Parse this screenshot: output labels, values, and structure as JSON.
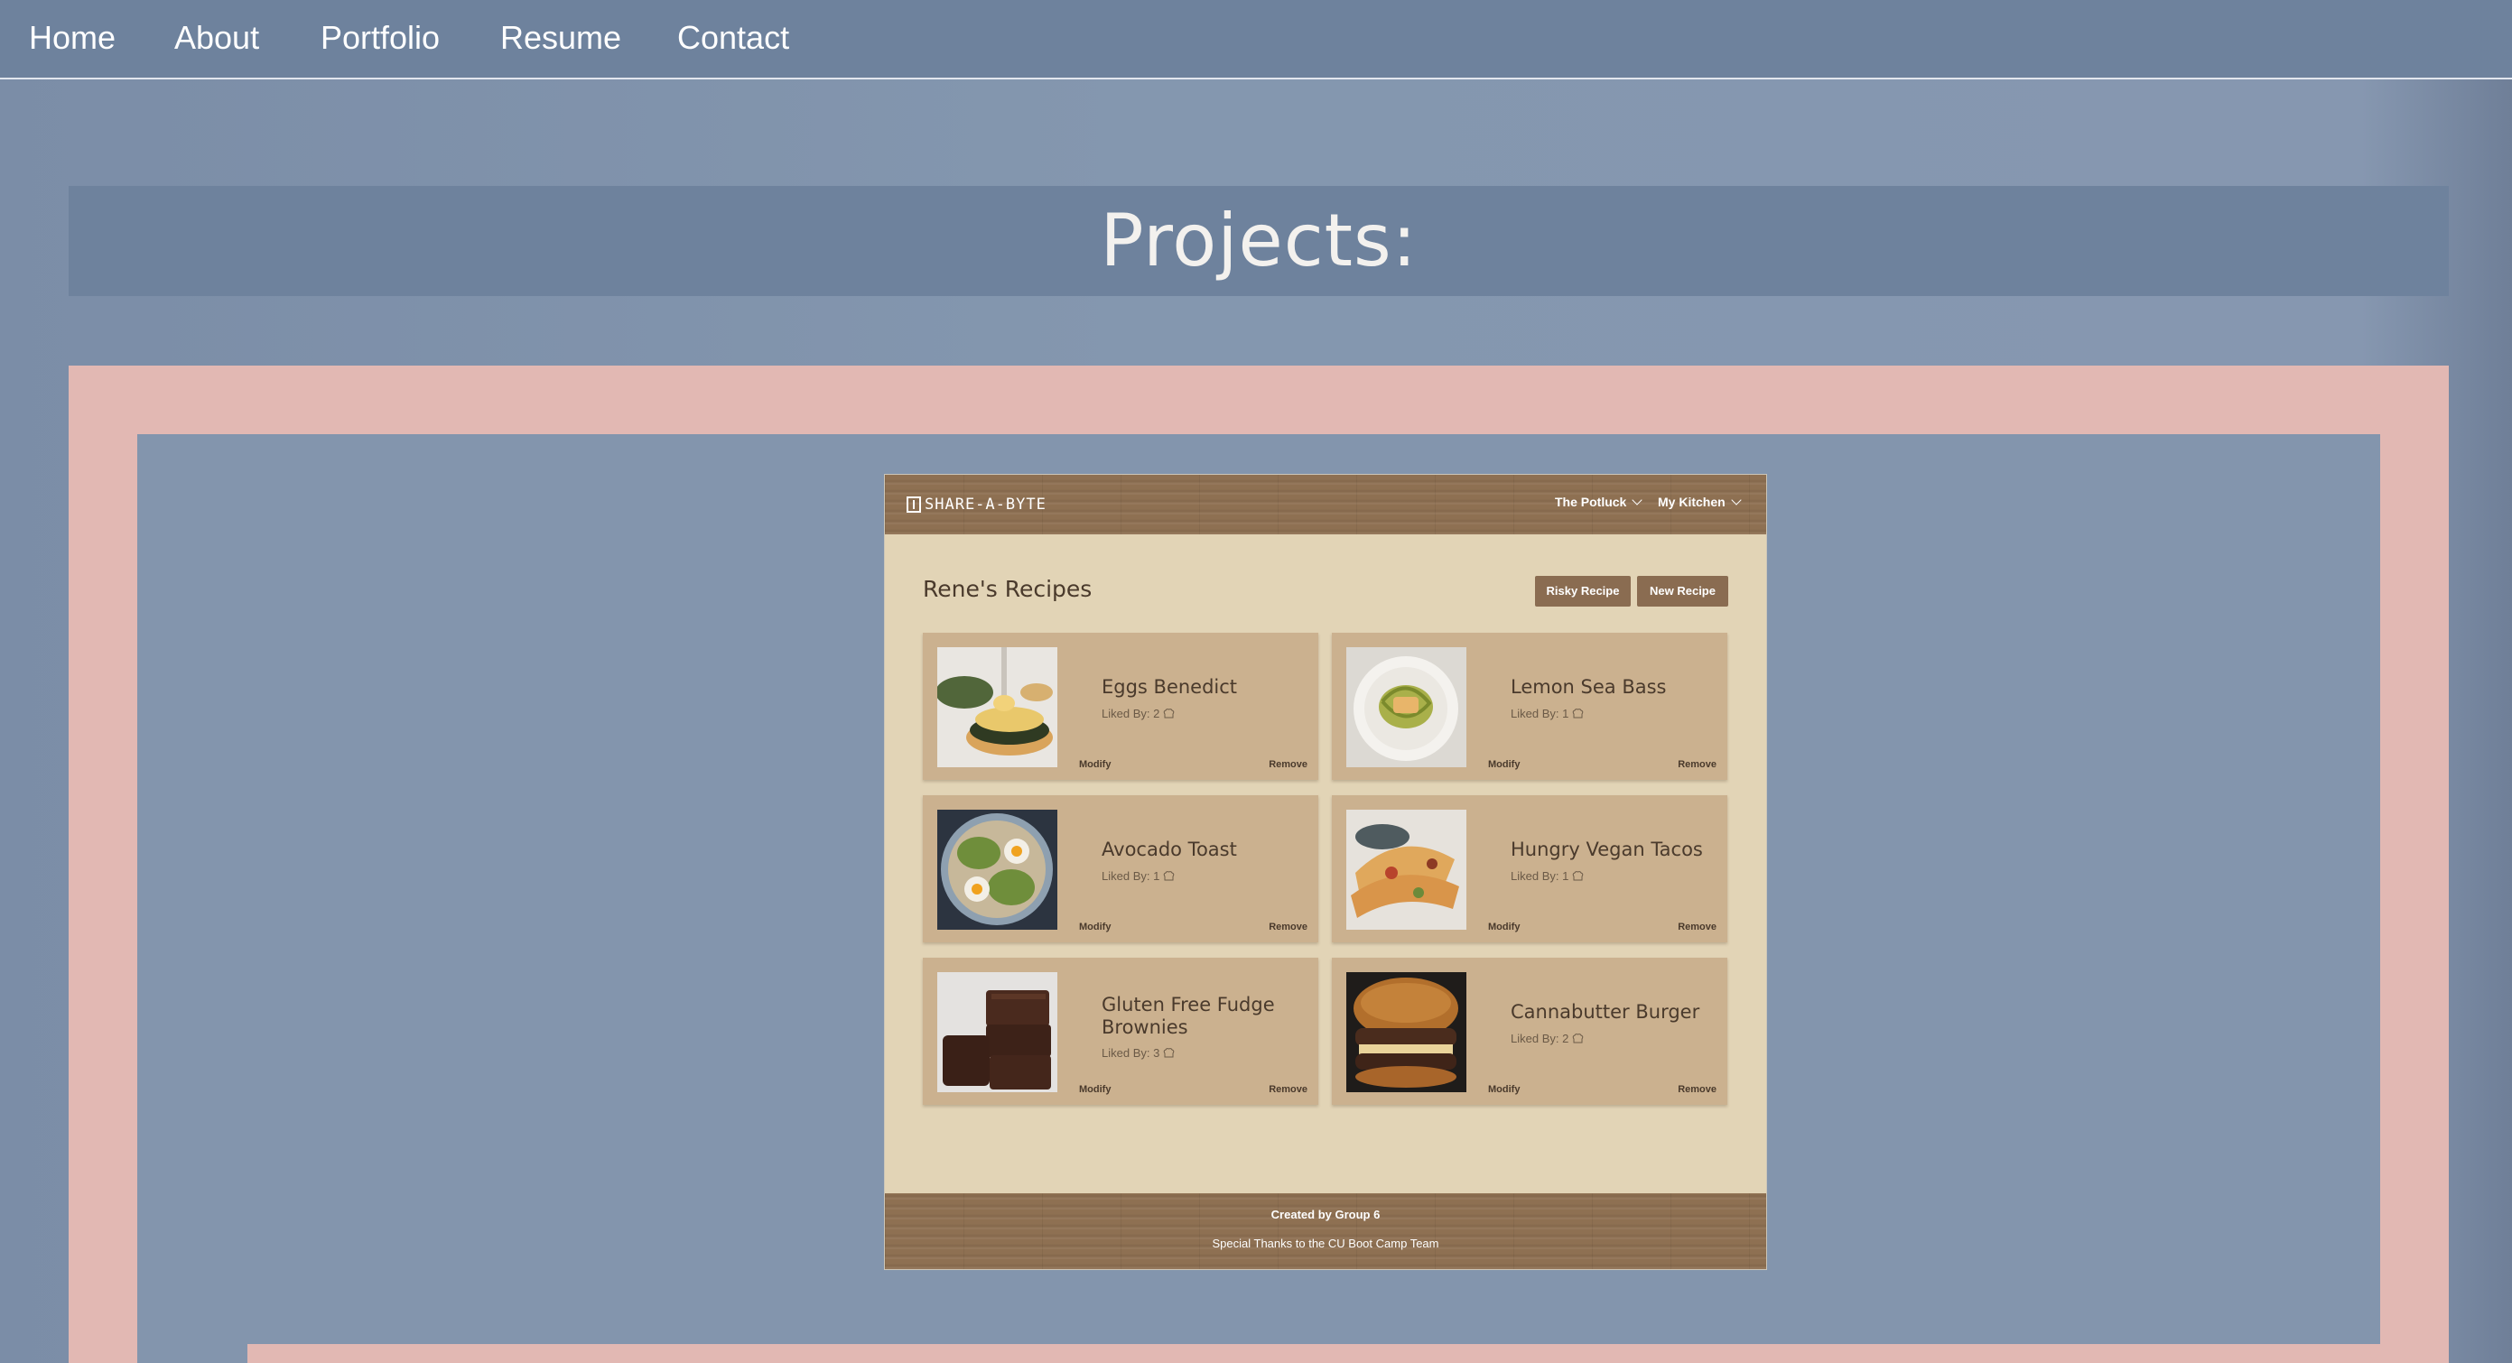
{
  "nav": {
    "items": [
      {
        "label": "Home"
      },
      {
        "label": "About"
      },
      {
        "label": "Portfolio"
      },
      {
        "label": "Resume"
      },
      {
        "label": "Contact"
      }
    ]
  },
  "page": {
    "title": "Projects:"
  },
  "app": {
    "logo_text": "SHARE-A-BYTE",
    "menus": [
      {
        "label": "The Potluck"
      },
      {
        "label": "My Kitchen"
      }
    ],
    "heading": "Rene's Recipes",
    "buttons": {
      "risky": "Risky Recipe",
      "new": "New Recipe"
    },
    "liked_prefix": "Liked By:",
    "action_modify": "Modify",
    "action_remove": "Remove",
    "recipes": [
      {
        "name": "Eggs Benedict",
        "liked": "2"
      },
      {
        "name": "Lemon Sea Bass",
        "liked": "1"
      },
      {
        "name": "Avocado Toast",
        "liked": "1"
      },
      {
        "name": "Hungry Vegan Tacos",
        "liked": "1"
      },
      {
        "name": "Gluten Free Fudge Brownies",
        "liked": "3"
      },
      {
        "name": "Cannabutter Burger",
        "liked": "2"
      }
    ],
    "footer": {
      "credit": "Created by Group 6",
      "thanks": "Special Thanks to the CU Boot Camp Team"
    }
  },
  "colors": {
    "nav_bg": "#6e829d",
    "frame_pink": "#e2b8b3",
    "app_bg": "#e2d4b6",
    "card_bg": "#cbb18f",
    "button_brown": "#8a6c51"
  }
}
